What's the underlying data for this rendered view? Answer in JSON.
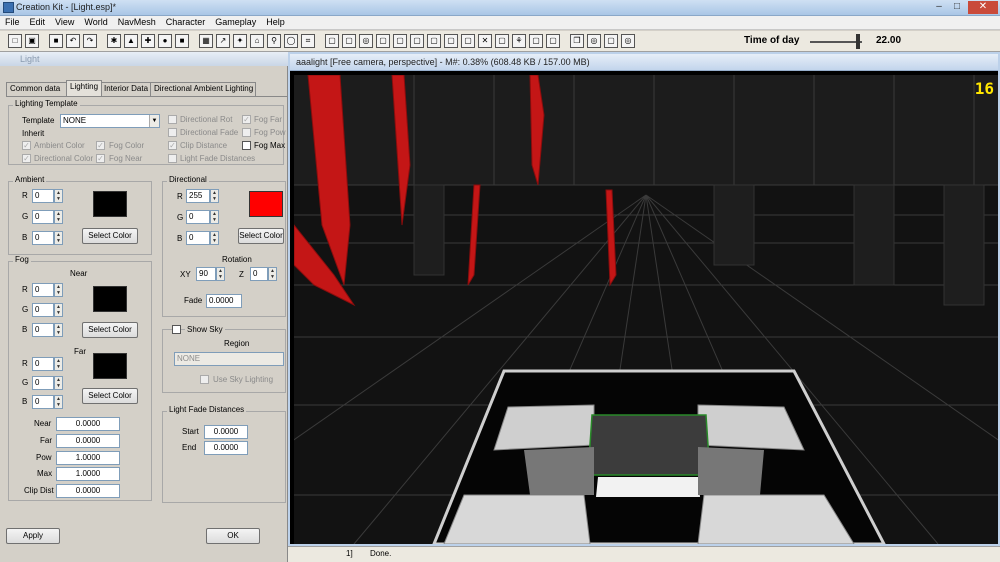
{
  "window": {
    "title": "Creation Kit - [Light.esp]*",
    "minimize": "–",
    "maximize": "□",
    "close": "✕"
  },
  "menu": [
    "File",
    "Edit",
    "View",
    "World",
    "NavMesh",
    "Character",
    "Gameplay",
    "Help"
  ],
  "toolbar": {
    "time_of_day_label": "Time of day",
    "time_of_day_value": "22.00",
    "time_of_day_fraction": 0.92
  },
  "dialog": {
    "title": "Light",
    "tabs": [
      "Common data",
      "Lighting",
      "Interior Data",
      "Directional Ambient Lighting"
    ],
    "active_tab": "Lighting",
    "lighting_template": {
      "group_label": "Lighting Template",
      "template_label": "Template",
      "template_value": "NONE",
      "inherit_label": "Inherit",
      "inherit": [
        {
          "label": "Ambient Color",
          "checked": true
        },
        {
          "label": "Fog Color",
          "checked": true
        },
        {
          "label": "Directional Color",
          "checked": true
        },
        {
          "label": "Fog Near",
          "checked": true
        },
        {
          "label": "Directional Rot",
          "checked": false
        },
        {
          "label": "Directional Fade",
          "checked": false
        },
        {
          "label": "Clip Distance",
          "checked": true
        },
        {
          "label": "Light Fade Distances",
          "checked": false
        },
        {
          "label": "Fog Far",
          "checked": true
        },
        {
          "label": "Fog Pow",
          "checked": false
        },
        {
          "label": "Fog Max",
          "checked": false
        }
      ]
    },
    "ambient": {
      "group_label": "Ambient",
      "r_label": "R",
      "g_label": "G",
      "b_label": "B",
      "r": "0",
      "g": "0",
      "b": "0",
      "color": "#000000",
      "select_color": "Select Color"
    },
    "directional": {
      "group_label": "Directional",
      "r_label": "R",
      "g_label": "G",
      "b_label": "B",
      "r": "255",
      "g": "0",
      "b": "0",
      "color": "#ff0000",
      "select_color": "Select Color",
      "rotation_label": "Rotation",
      "xy_label": "XY",
      "xy": "90",
      "z_label": "Z",
      "z": "0",
      "fade_label": "Fade",
      "fade": "0.0000"
    },
    "fog": {
      "group_label": "Fog",
      "near_label": "Near",
      "near": {
        "r": "0",
        "g": "0",
        "b": "0",
        "color": "#000000",
        "select_color": "Select Color"
      },
      "far_label": "Far",
      "far": {
        "r": "0",
        "g": "0",
        "b": "0",
        "color": "#000000",
        "select_color": "Select Color"
      },
      "r_label": "R",
      "g_label": "G",
      "b_label": "B",
      "fields": [
        {
          "label": "Near",
          "value": "0.0000"
        },
        {
          "label": "Far",
          "value": "0.0000"
        },
        {
          "label": "Pow",
          "value": "1.0000"
        },
        {
          "label": "Max",
          "value": "1.0000"
        },
        {
          "label": "Clip Dist",
          "value": "0.0000"
        }
      ]
    },
    "sky": {
      "show_sky_label": "Show Sky",
      "region_label": "Region",
      "region_value": "NONE",
      "use_sky_lighting": "Use Sky Lighting"
    },
    "light_fade": {
      "group_label": "Light Fade Distances",
      "start_label": "Start",
      "start": "0.0000",
      "end_label": "End",
      "end": "0.0000"
    },
    "apply_label": "Apply",
    "ok_label": "OK"
  },
  "viewport": {
    "title": "aaalight [Free camera, perspective] - M#: 0.38% (608.48 KB / 157.00 MB)",
    "fps": "16"
  },
  "status": {
    "left": "1]",
    "right": "Done."
  },
  "colors": {
    "accent_red": "#d61f1f",
    "fps_yellow": "#ffe600"
  }
}
